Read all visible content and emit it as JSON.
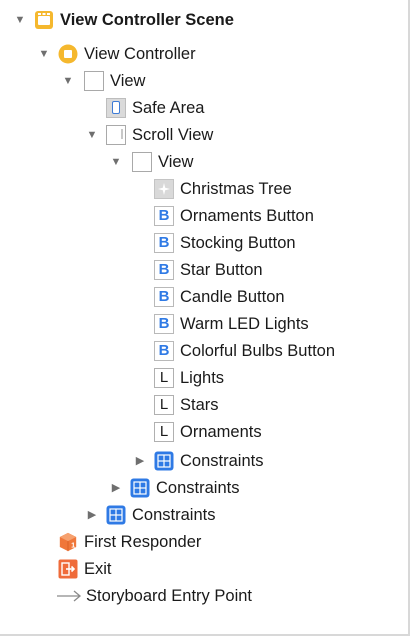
{
  "tree": {
    "scene": {
      "label": "View Controller Scene",
      "icon": "storyboard-scene-icon"
    },
    "view_controller": {
      "label": "View Controller",
      "icon": "view-controller-icon"
    },
    "root_view": {
      "label": "View",
      "icon": "view-icon"
    },
    "safe_area": {
      "label": "Safe Area",
      "icon": "safe-area-icon"
    },
    "scroll_view": {
      "label": "Scroll View",
      "icon": "scroll-view-icon"
    },
    "content_view": {
      "label": "View",
      "icon": "view-icon"
    },
    "content_items": [
      {
        "label": "Christmas Tree",
        "icon": "image-view-icon",
        "glyph": ""
      },
      {
        "label": "Ornaments Button",
        "icon": "button-icon",
        "glyph": "B"
      },
      {
        "label": "Stocking Button",
        "icon": "button-icon",
        "glyph": "B"
      },
      {
        "label": "Star Button",
        "icon": "button-icon",
        "glyph": "B"
      },
      {
        "label": "Candle Button",
        "icon": "button-icon",
        "glyph": "B"
      },
      {
        "label": "Warm LED Lights",
        "icon": "button-icon",
        "glyph": "B"
      },
      {
        "label": "Colorful Bulbs Button",
        "icon": "button-icon",
        "glyph": "B"
      },
      {
        "label": "Lights",
        "icon": "label-icon",
        "glyph": "L"
      },
      {
        "label": "Stars",
        "icon": "label-icon",
        "glyph": "L"
      },
      {
        "label": "Ornaments",
        "icon": "label-icon",
        "glyph": "L"
      }
    ],
    "content_constraints": {
      "label": "Constraints",
      "icon": "constraints-icon"
    },
    "scroll_constraints": {
      "label": "Constraints",
      "icon": "constraints-icon"
    },
    "root_constraints": {
      "label": "Constraints",
      "icon": "constraints-icon"
    },
    "first_responder": {
      "label": "First Responder",
      "icon": "first-responder-icon"
    },
    "exit": {
      "label": "Exit",
      "icon": "exit-icon"
    },
    "entry_point": {
      "label": "Storyboard Entry Point",
      "icon": "arrow-right-icon"
    }
  },
  "colors": {
    "accent_blue": "#2f7ae5",
    "scene_yellow": "#f5b82e",
    "responder_orange": "#f0773a",
    "exit_orange": "#ef6b3a"
  }
}
